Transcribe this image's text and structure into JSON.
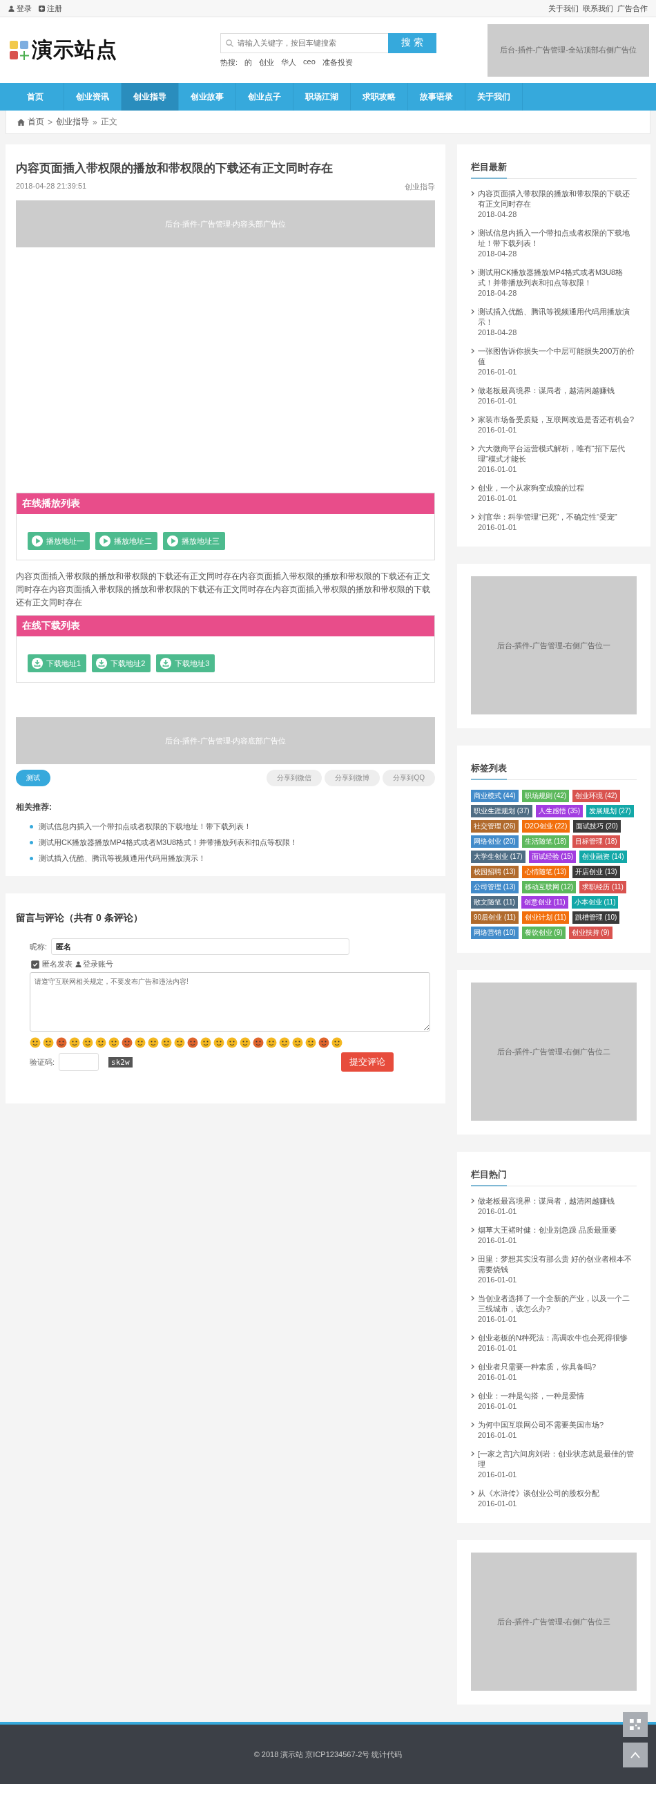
{
  "top_bar": {
    "left_links": [
      {
        "kind": "user",
        "label": "登录"
      },
      {
        "kind": "plus",
        "label": "注册"
      }
    ],
    "right_links": [
      "关于我们",
      "联系我们",
      "广告合作"
    ]
  },
  "header": {
    "logo_text": "演示站点",
    "search": {
      "placeholder": "请输入关键字，按回车键搜索",
      "button": "搜 索"
    },
    "hot_label": "热搜:",
    "hot_terms": [
      "的",
      "创业",
      "华人",
      "ceo",
      "准备投资"
    ],
    "ad": "后台-插件-广告管理-全站顶部右侧广告位"
  },
  "nav": [
    {
      "label": "首页",
      "selected": false
    },
    {
      "label": "创业资讯",
      "selected": false
    },
    {
      "label": "创业指导",
      "selected": true
    },
    {
      "label": "创业故事",
      "selected": false
    },
    {
      "label": "创业点子",
      "selected": false
    },
    {
      "label": "职场江湖",
      "selected": false
    },
    {
      "label": "求职攻略",
      "selected": false
    },
    {
      "label": "故事语录",
      "selected": false
    },
    {
      "label": "关于我们",
      "selected": false
    }
  ],
  "breadcrumb": [
    {
      "kind": "link",
      "text": "首页"
    },
    {
      "kind": "sep",
      "text": ">"
    },
    {
      "kind": "link",
      "text": "创业指导"
    },
    {
      "kind": "sep",
      "text": "»"
    },
    {
      "kind": "text",
      "text": "正文"
    }
  ],
  "article": {
    "title": "内容页面插入带权限的播放和带权限的下载还有正文同时存在",
    "date": "2018-04-28 21:39:51",
    "category": "创业指导",
    "top_ad": "后台-插件-广告管理-内容头部广告位",
    "play_list": {
      "title": "在线播放列表",
      "items": [
        "播放地址一",
        "播放地址二",
        "播放地址三"
      ]
    },
    "body": "内容页面插入带权限的播放和带权限的下载还有正文同时存在内容页面插入带权限的播放和带权限的下载还有正文同时存在内容页面插入带权限的播放和带权限的下载还有正文同时存在内容页面插入带权限的播放和带权限的下载还有正文同时存在",
    "download_list": {
      "title": "在线下载列表",
      "items": [
        "下载地址1",
        "下载地址2",
        "下载地址3"
      ]
    },
    "bottom_ad": "后台-插件-广告管理-内容底部广告位",
    "tag": "测试",
    "share": [
      "分享到微信",
      "分享到微博",
      "分享到QQ"
    ],
    "related_title": "相关推荐:",
    "related": [
      "测试信息内插入一个带扣点或者权限的下载地址！带下载列表！",
      "测试用CK播放器播放MP4格式或者M3U8格式！并带播放列表和扣点等权限！",
      "测试插入优酷、腾讯等视频通用代码用播放演示！"
    ]
  },
  "comments": {
    "title": "留言与评论（共有 0 条评论）",
    "nickname_label": "昵称:",
    "nickname_value": "匿名",
    "anonymous_checked": true,
    "anonymous_label": "匿名发表",
    "login_link": "登录账号",
    "textarea_placeholder": "请遵守互联网相关规定，不要发布广告和违法内容!",
    "captcha_label": "验证码:",
    "captcha_code": "sk2w",
    "submit": "提交评论"
  },
  "sidebar": {
    "latest": {
      "title": "栏目最新",
      "items": [
        {
          "title": "内容页面插入带权限的播放和带权限的下载还有正文同时存在",
          "date": "2018-04-28"
        },
        {
          "title": "测试信息内插入一个带扣点或者权限的下载地址！带下载列表！",
          "date": "2018-04-28"
        },
        {
          "title": "测试用CK播放器播放MP4格式或者M3U8格式！并带播放列表和扣点等权限！",
          "date": "2018-04-28"
        },
        {
          "title": "测试插入优酷、腾讯等视频通用代码用播放演示！",
          "date": "2018-04-28"
        },
        {
          "title": "一张图告诉你损失一个中层可能损失200万的价值",
          "date": "2016-01-01"
        },
        {
          "title": "做老板最高境界：谋局者，越清闲越赚钱",
          "date": "2016-01-01"
        },
        {
          "title": "家装市场备受质疑，互联网改造是否还有机会?",
          "date": "2016-01-01"
        },
        {
          "title": "六大微商平台运营模式解析，唯有“招下层代理”模式才能长",
          "date": "2016-01-01"
        },
        {
          "title": "创业，一个从家狗变成狼的过程",
          "date": "2016-01-01"
        },
        {
          "title": "刘官华：科学管理“已死”，不确定性“受宠”",
          "date": "2016-01-01"
        }
      ]
    },
    "ad_1": "后台-插件-广告管理-右侧广告位一",
    "tags": {
      "title": "标签列表",
      "items": [
        {
          "label": "商业模式 (44)",
          "color": "#428bca"
        },
        {
          "label": "职场规则 (42)",
          "color": "#5cb85c"
        },
        {
          "label": "创业环境 (42)",
          "color": "#d9534f"
        },
        {
          "label": "职业生涯规划 (37)",
          "color": "#4f6d84"
        },
        {
          "label": "人生感悟 (35)",
          "color": "#a23de0"
        },
        {
          "label": "发展规划 (27)",
          "color": "#13a8a8"
        },
        {
          "label": "社交管理 (26)",
          "color": "#b06a2c"
        },
        {
          "label": "O2O创业 (22)",
          "color": "#f26f0c"
        },
        {
          "label": "面试技巧 (20)",
          "color": "#3a3a3a"
        },
        {
          "label": "网络创业 (20)",
          "color": "#428bca"
        },
        {
          "label": "生活随笔 (18)",
          "color": "#5cb85c"
        },
        {
          "label": "目标管理 (18)",
          "color": "#d9534f"
        },
        {
          "label": "大学生创业 (17)",
          "color": "#4f6d84"
        },
        {
          "label": "面试经验 (15)",
          "color": "#a23de0"
        },
        {
          "label": "创业融资 (14)",
          "color": "#13a8a8"
        },
        {
          "label": "校园招聘 (13)",
          "color": "#b06a2c"
        },
        {
          "label": "心情随笔 (13)",
          "color": "#f26f0c"
        },
        {
          "label": "开店创业 (13)",
          "color": "#3a3a3a"
        },
        {
          "label": "公司管理 (13)",
          "color": "#428bca"
        },
        {
          "label": "移动互联网 (12)",
          "color": "#5cb85c"
        },
        {
          "label": "求职经历 (11)",
          "color": "#d9534f"
        },
        {
          "label": "散文随笔 (11)",
          "color": "#4f6d84"
        },
        {
          "label": "创意创业 (11)",
          "color": "#a23de0"
        },
        {
          "label": "小本创业 (11)",
          "color": "#13a8a8"
        },
        {
          "label": "90后创业 (11)",
          "color": "#b06a2c"
        },
        {
          "label": "创业计划 (11)",
          "color": "#f26f0c"
        },
        {
          "label": "跳槽管理 (10)",
          "color": "#3a3a3a"
        },
        {
          "label": "网络营销 (10)",
          "color": "#428bca"
        },
        {
          "label": "餐饮创业 (9)",
          "color": "#5cb85c"
        },
        {
          "label": "创业扶持 (9)",
          "color": "#d9534f"
        }
      ]
    },
    "ad_2": "后台-插件-广告管理-右侧广告位二",
    "hot": {
      "title": "栏目热门",
      "items": [
        {
          "title": "做老板最高境界：谋局者，越清闲越赚钱",
          "date": "2016-01-01"
        },
        {
          "title": "烟草大王褚时健：创业别急躁 品质最重要",
          "date": "2016-01-01"
        },
        {
          "title": "田里：梦想其实没有那么贵 好的创业者根本不需要烧钱",
          "date": "2016-01-01"
        },
        {
          "title": "当创业者选择了一个全新的产业，以及一个二三线城市，该怎么办?",
          "date": "2016-01-01"
        },
        {
          "title": "创业老板的N种死法：高调吹牛也会死得很惨",
          "date": "2016-01-01"
        },
        {
          "title": "创业者只需要一种素质，你具备吗?",
          "date": "2016-01-01"
        },
        {
          "title": "创业：一种是勾搭，一种是爱情",
          "date": "2016-01-01"
        },
        {
          "title": "为何中国互联网公司不需要美国市场?",
          "date": "2016-01-01"
        },
        {
          "title": "[一家之言]六间房刘岩：创业状态就是最佳的管理",
          "date": "2016-01-01"
        },
        {
          "title": "从《水浒传》谈创业公司的股权分配",
          "date": "2016-01-01"
        }
      ]
    },
    "ad_3": "后台-插件-广告管理-右侧广告位三"
  },
  "footer": {
    "copyright": "© 2018 演示站 京ICP1234567-2号 统计代码"
  }
}
